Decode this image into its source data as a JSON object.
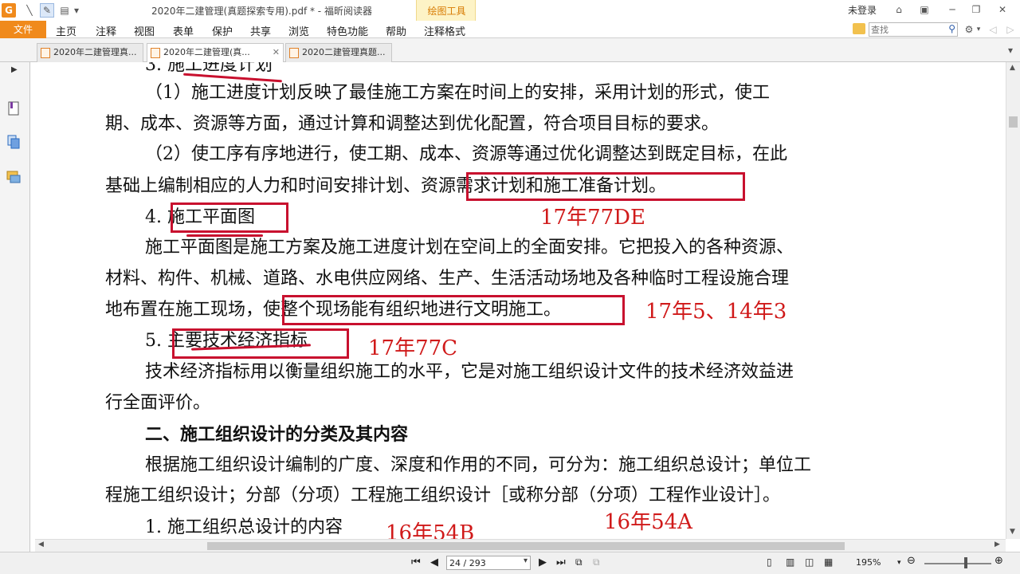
{
  "window": {
    "title": "2020年二建管理(真题探索专用).pdf * - 福昕阅读器",
    "tool_context_tab": "绘图工具",
    "login": "未登录"
  },
  "ribbon": {
    "file": "文件",
    "tabs": [
      "主页",
      "注释",
      "视图",
      "表单",
      "保护",
      "共享",
      "浏览",
      "特色功能",
      "帮助",
      "注释格式"
    ]
  },
  "search": {
    "placeholder": "查找"
  },
  "doc_tabs": [
    {
      "label": "2020年二建管理真..."
    },
    {
      "label": "2020年二建管理(真..."
    },
    {
      "label": "2020二建管理真题..."
    }
  ],
  "document": {
    "lines": [
      "3. 施工进度计划",
      "（1）施工进度计划反映了最佳施工方案在时间上的安排，采用计划的形式，使工",
      "期、成本、资源等方面，通过计算和调整达到优化配置，符合项目目标的要求。",
      "（2）使工序有序地进行，使工期、成本、资源等通过优化调整达到既定目标，在此",
      "基础上编制相应的人力和时间安排计划、资源需求计划和施工准备计划。",
      "4. 施工平面图",
      "施工平面图是施工方案及施工进度计划在空间上的全面安排。它把投入的各种资源、",
      "材料、构件、机械、道路、水电供应网络、生产、生活活动场地及各种临时工程设施合理",
      "地布置在施工现场，使整个现场能有组织地进行文明施工。",
      "5. 主要技术经济指标",
      "技术经济指标用以衡量组织施工的水平，它是对施工组织设计文件的技术经济效益进",
      "行全面评价。",
      "二、施工组织设计的分类及其内容",
      "根据施工组织设计编制的广度、深度和作用的不同，可分为：施工组织总设计；单位工",
      "程施工组织设计；分部（分项）工程施工组织设计［或称分部（分项）工程作业设计］。",
      "1. 施工组织总设计的内容"
    ],
    "annotations": [
      "17年77DE",
      "17年5、14年3",
      "17年77C",
      "16年54B",
      "16年54A"
    ]
  },
  "status": {
    "page": "24 / 293",
    "zoom": "195%"
  }
}
